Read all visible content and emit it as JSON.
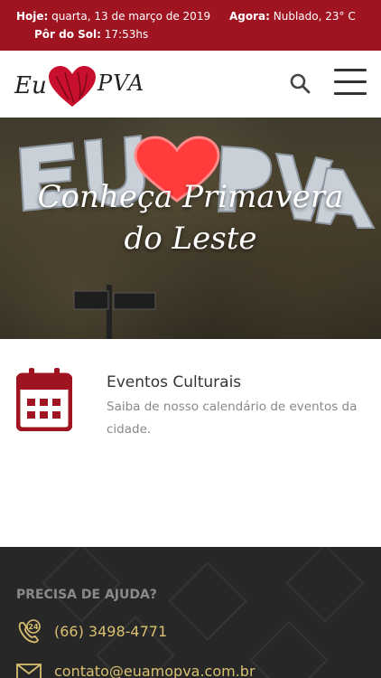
{
  "topbar": {
    "today_label": "Hoje:",
    "today_value": "quarta, 13 de março de 2019",
    "now_label": "Agora:",
    "now_value": "Nublado, 23° C",
    "sunset_label": "Pôr do Sol:",
    "sunset_value": "17:53hs"
  },
  "header": {
    "logo_eu": "Eu",
    "logo_pva": "PVA",
    "search_icon": "search-icon",
    "menu_icon": "hamburger-menu-icon"
  },
  "hero": {
    "line1": "Conheça Primavera",
    "line2": "do Leste"
  },
  "feature": {
    "icon": "calendar-icon",
    "title": "Eventos Culturais",
    "description": "Saiba de nosso calendário de eventos da cidade."
  },
  "footer": {
    "heading": "PRECISA DE AJUDA?",
    "phone": "(66) 3498-4771",
    "email": "contato@euamopva.com.br"
  },
  "colors": {
    "brand_red": "#a01422",
    "footer_bg": "#272727",
    "contact_gold": "#d8c070"
  }
}
